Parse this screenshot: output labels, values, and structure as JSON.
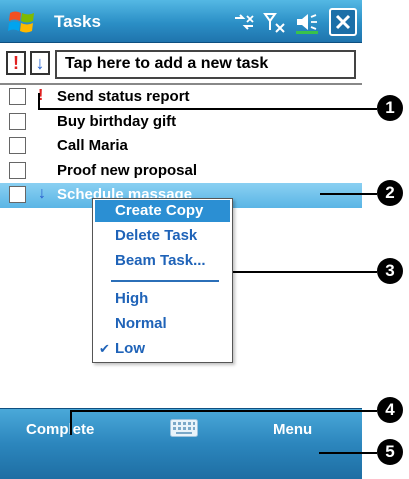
{
  "titlebar": {
    "title": "Tasks"
  },
  "toolbar": {
    "high_priority_glyph": "!",
    "low_priority_glyph": "↓",
    "new_task_placeholder": "Tap here to add a new task"
  },
  "tasks": [
    {
      "label": "Send status report",
      "priority": "high",
      "priority_glyph": "!",
      "selected": false
    },
    {
      "label": "Buy birthday gift",
      "priority": "normal",
      "priority_glyph": "",
      "selected": false
    },
    {
      "label": "Call Maria",
      "priority": "normal",
      "priority_glyph": "",
      "selected": false
    },
    {
      "label": "Proof new proposal",
      "priority": "normal",
      "priority_glyph": "",
      "selected": false
    },
    {
      "label": "Schedule massage",
      "priority": "low",
      "priority_glyph": "↓",
      "selected": true
    }
  ],
  "context_menu": {
    "items": [
      "Create Copy",
      "Delete Task",
      "Beam Task..."
    ],
    "priority_items": [
      "High",
      "Normal",
      "Low"
    ],
    "checked_item": "Low",
    "check_glyph": "✔"
  },
  "softkeys": {
    "left": "Complete",
    "right": "Menu"
  },
  "callouts": [
    "1",
    "2",
    "3",
    "4",
    "5"
  ],
  "colors": {
    "titlebar": "#2b8fc6",
    "selection": "#5ab5e5",
    "menu_text": "#1f63b8",
    "high_priority": "#e02020",
    "low_priority": "#2a5fcf"
  }
}
